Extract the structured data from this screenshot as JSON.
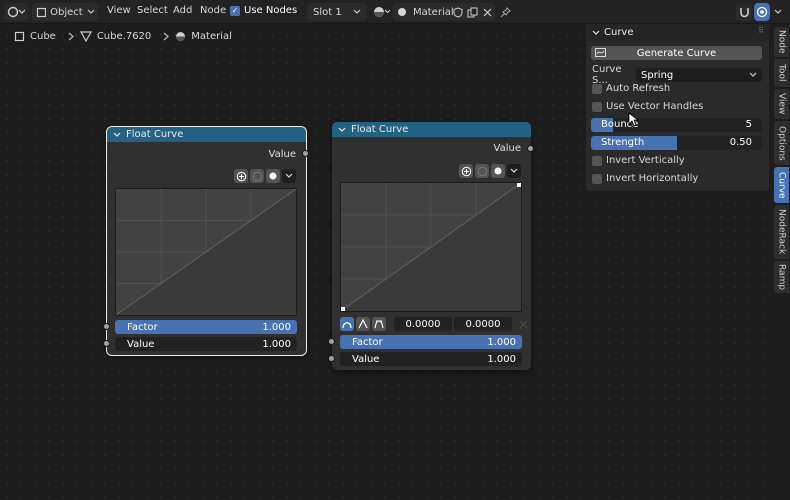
{
  "header": {
    "mode": "Object",
    "menus": [
      "View",
      "Select",
      "Add",
      "Node"
    ],
    "use_nodes_label": "Use Nodes",
    "slot": "Slot 1",
    "material": "Material"
  },
  "breadcrumbs": [
    "Cube",
    "Cube.7620",
    "Material"
  ],
  "node1": {
    "title": "Float Curve",
    "output": "Value",
    "factor_label": "Factor",
    "factor_value": "1.000",
    "value_label": "Value",
    "value_value": "1.000"
  },
  "node2": {
    "title": "Float Curve",
    "output": "Value",
    "point_x": "0.0000",
    "point_y": "0.0000",
    "factor_label": "Factor",
    "factor_value": "1.000",
    "value_label": "Value",
    "value_value": "1.000"
  },
  "panel": {
    "title": "Curve",
    "generate_label": "Generate Curve",
    "curve_select_label": "Curve S...",
    "curve_select_value": "Spring",
    "auto_refresh": "Auto Refresh",
    "use_vector_handles": "Use Vector Handles",
    "bounce_label": "Bounce",
    "bounce_value": "5",
    "bounce_fraction": 0.13,
    "strength_label": "Strength",
    "strength_value": "0.50",
    "strength_fraction": 0.5,
    "invert_vertically": "Invert Vertically",
    "invert_horizontally": "Invert Horizontally"
  },
  "tabs": [
    "Node",
    "Tool",
    "View",
    "Options",
    "Curve",
    "NodeRack",
    "Ramp"
  ],
  "active_tab": "Curve",
  "colors": {
    "accent": "#4772b3",
    "node_header": "#246283",
    "background": "#1d1d1d"
  }
}
